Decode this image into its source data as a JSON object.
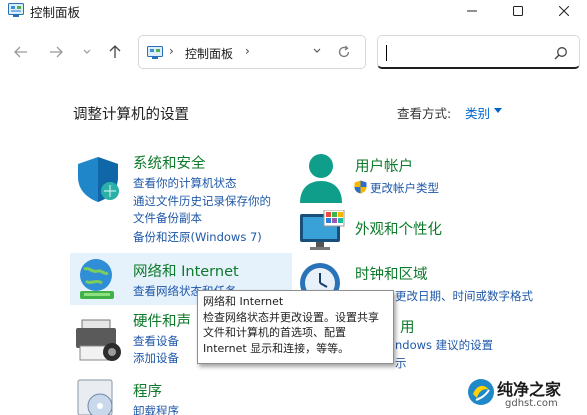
{
  "window": {
    "title": "控制面板",
    "buttons": {
      "minimize": "minimize-icon",
      "maximize": "maximize-icon",
      "close": "close-icon"
    }
  },
  "nav": {
    "back_icon": "arrow-left-icon",
    "forward_icon": "arrow-right-icon",
    "recent_icon": "chevron-down-icon",
    "up_icon": "arrow-up-icon",
    "address": {
      "separator": "›",
      "location": "控制面板",
      "trailing_separator": "›"
    },
    "search": {
      "value": ""
    }
  },
  "header": {
    "title": "调整计算机的设置",
    "view_by_label": "查看方式:",
    "view_by_value": "类别"
  },
  "categories": {
    "system": {
      "title": "系统和安全",
      "links": [
        "查看你的计算机状态",
        "通过文件历史记录保存你的",
        "文件备份副本",
        "备份和还原(Windows 7)"
      ]
    },
    "network": {
      "title": "网络和 Internet",
      "links": [
        "查看网络状态和任务"
      ]
    },
    "hardware": {
      "title": "硬件和声",
      "links": [
        "查看设备",
        "添加设备"
      ]
    },
    "programs": {
      "title": "程序",
      "links": [
        "卸载程序"
      ]
    },
    "users": {
      "title": "用户帐户",
      "links": [
        "更改帐户类型"
      ]
    },
    "appearance": {
      "title": "外观和个性化",
      "links": []
    },
    "clock": {
      "title": "时钟和区域",
      "links": [
        "更改日期、时间或数字格式"
      ]
    },
    "ease": {
      "title": "用",
      "links": [
        "ndows 建议的设置",
        "示"
      ]
    }
  },
  "tooltip": {
    "lines": [
      "网络和 Internet",
      "检查网络状态并更改设置。设置共享",
      "文件和计算机的首选项、配置",
      "Internet 显示和连接，等等。"
    ]
  },
  "watermark": {
    "text": "纯净之家",
    "url": "gdhst.com"
  },
  "colors": {
    "link": "#1f58a8",
    "category_title": "#0c7a2a",
    "accent": "#0066cc",
    "hover": "#e5f1fb"
  }
}
